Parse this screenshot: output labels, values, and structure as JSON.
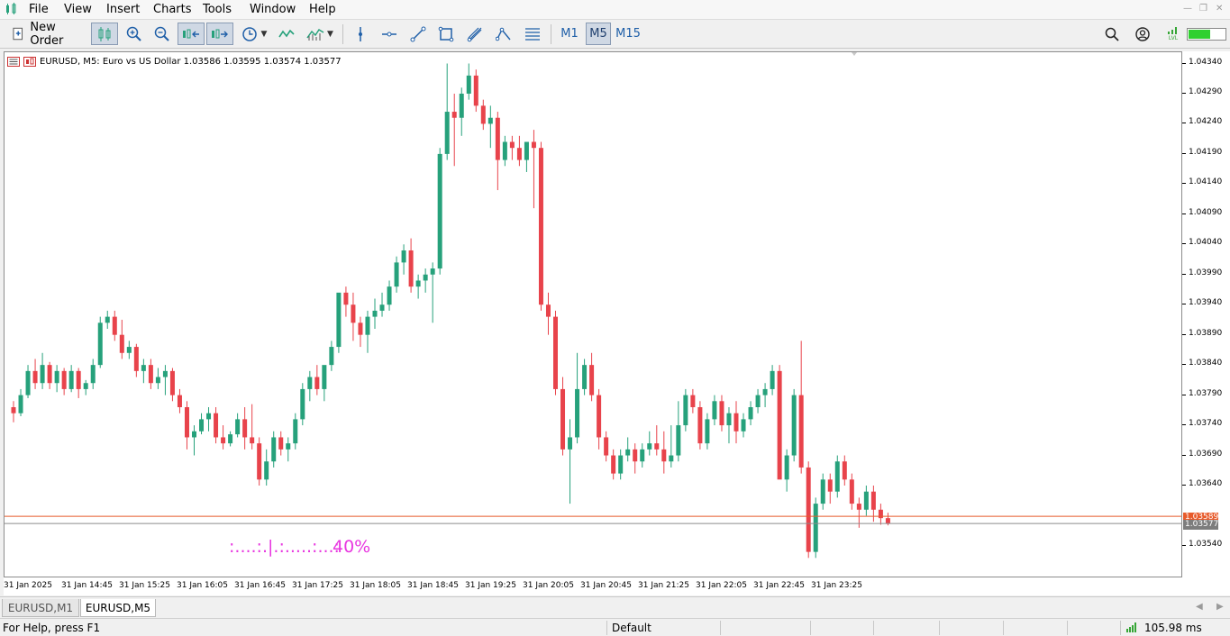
{
  "menu": {
    "items": [
      "File",
      "View",
      "Insert",
      "Charts",
      "Tools",
      "Window",
      "Help"
    ]
  },
  "toolbar": {
    "new_order_label": "New Order",
    "timeframes": [
      "M1",
      "M5",
      "M15"
    ],
    "active_timeframe": "M5",
    "connection_label": "LVL"
  },
  "chart": {
    "symbol": "EURUSD",
    "timeframe": "M5",
    "description": "Euro vs US Dollar",
    "ohlc": "1.03586 1.03595 1.03574 1.03577",
    "title_text": "EURUSD, M5:  Euro vs US Dollar  1.03586 1.03595 1.03574 1.03577",
    "indicator_text": ":....:.|.:.....:...:",
    "indicator_pct": "40%",
    "colors": {
      "bull": "#26a17b",
      "bear": "#e8434b",
      "ask_line": "#e85a2a",
      "bid_line": "#8c8c8c",
      "indicator": "#e838e0"
    }
  },
  "chart_data": {
    "type": "candlestick",
    "title": "EURUSD, M5:  Euro vs US Dollar  1.03586 1.03595 1.03574 1.03577",
    "price_axis_labels": [
      "1.04340",
      "1.04290",
      "1.04240",
      "1.04190",
      "1.04140",
      "1.04090",
      "1.04040",
      "1.03990",
      "1.03940",
      "1.03890",
      "1.03840",
      "1.03790",
      "1.03740",
      "1.03690",
      "1.03640",
      "1.03589",
      "1.03577",
      "1.03540"
    ],
    "time_axis_labels": [
      "31 Jan 2025",
      "31 Jan 14:45",
      "31 Jan 15:25",
      "31 Jan 16:05",
      "31 Jan 16:45",
      "31 Jan 17:25",
      "31 Jan 18:05",
      "31 Jan 18:45",
      "31 Jan 19:25",
      "31 Jan 20:05",
      "31 Jan 20:45",
      "31 Jan 21:25",
      "31 Jan 22:05",
      "31 Jan 22:45",
      "31 Jan 23:25"
    ],
    "ylim": [
      1.035,
      1.04355
    ],
    "ask_price": "1.03589",
    "bid_price": "1.03577",
    "candles": [
      [
        1.0377,
        1.0378,
        1.03745,
        1.0376
      ],
      [
        1.0376,
        1.038,
        1.03755,
        1.0379
      ],
      [
        1.0379,
        1.0384,
        1.03785,
        1.0383
      ],
      [
        1.0383,
        1.0385,
        1.038,
        1.0381
      ],
      [
        1.0381,
        1.0386,
        1.038,
        1.0384
      ],
      [
        1.0384,
        1.03845,
        1.038,
        1.0381
      ],
      [
        1.0381,
        1.0384,
        1.03795,
        1.0383
      ],
      [
        1.0383,
        1.03835,
        1.0379,
        1.038
      ],
      [
        1.038,
        1.0384,
        1.03795,
        1.0383
      ],
      [
        1.0383,
        1.03835,
        1.03785,
        1.038
      ],
      [
        1.038,
        1.03815,
        1.0379,
        1.0381
      ],
      [
        1.0381,
        1.0385,
        1.038,
        1.0384
      ],
      [
        1.0384,
        1.0392,
        1.03835,
        1.0391
      ],
      [
        1.0391,
        1.0393,
        1.039,
        1.0392
      ],
      [
        1.0392,
        1.0393,
        1.0388,
        1.0389
      ],
      [
        1.0389,
        1.03915,
        1.0385,
        1.0386
      ],
      [
        1.0386,
        1.0388,
        1.0385,
        1.0387
      ],
      [
        1.0387,
        1.03875,
        1.0382,
        1.0383
      ],
      [
        1.0383,
        1.0385,
        1.0381,
        1.0384
      ],
      [
        1.0384,
        1.0385,
        1.038,
        1.0381
      ],
      [
        1.0381,
        1.03835,
        1.038,
        1.0382
      ],
      [
        1.0382,
        1.0384,
        1.0379,
        1.0383
      ],
      [
        1.0383,
        1.03835,
        1.0378,
        1.0379
      ],
      [
        1.0379,
        1.038,
        1.0376,
        1.0377
      ],
      [
        1.0377,
        1.0378,
        1.037,
        1.0372
      ],
      [
        1.0372,
        1.0374,
        1.0369,
        1.0373
      ],
      [
        1.0373,
        1.0376,
        1.03725,
        1.0375
      ],
      [
        1.0375,
        1.0377,
        1.0373,
        1.0376
      ],
      [
        1.0376,
        1.0377,
        1.0371,
        1.0372
      ],
      [
        1.0372,
        1.0374,
        1.037,
        1.0371
      ],
      [
        1.0371,
        1.0373,
        1.03705,
        1.03725
      ],
      [
        1.03725,
        1.0376,
        1.0372,
        1.0375
      ],
      [
        1.0375,
        1.0377,
        1.037,
        1.0372
      ],
      [
        1.0372,
        1.03775,
        1.037,
        1.0371
      ],
      [
        1.0371,
        1.0372,
        1.0364,
        1.0365
      ],
      [
        1.0365,
        1.037,
        1.0364,
        1.0368
      ],
      [
        1.0368,
        1.0373,
        1.0367,
        1.0372
      ],
      [
        1.0372,
        1.0373,
        1.0369,
        1.037
      ],
      [
        1.037,
        1.0372,
        1.0368,
        1.0371
      ],
      [
        1.0371,
        1.0376,
        1.037,
        1.0375
      ],
      [
        1.0375,
        1.0381,
        1.0374,
        1.038
      ],
      [
        1.038,
        1.0383,
        1.0378,
        1.0382
      ],
      [
        1.0382,
        1.0384,
        1.0379,
        1.038
      ],
      [
        1.038,
        1.0383,
        1.0378,
        1.0384
      ],
      [
        1.0384,
        1.0388,
        1.0383,
        1.0387
      ],
      [
        1.0387,
        1.03905,
        1.0386,
        1.0396
      ],
      [
        1.0396,
        1.0397,
        1.0392,
        1.0394
      ],
      [
        1.0394,
        1.0396,
        1.0388,
        1.0391
      ],
      [
        1.0391,
        1.0392,
        1.0387,
        1.0389
      ],
      [
        1.0389,
        1.0393,
        1.0386,
        1.0392
      ],
      [
        1.0392,
        1.0395,
        1.039,
        1.0393
      ],
      [
        1.0393,
        1.0396,
        1.0392,
        1.0394
      ],
      [
        1.0394,
        1.0398,
        1.0393,
        1.0397
      ],
      [
        1.0397,
        1.0402,
        1.0396,
        1.0401
      ],
      [
        1.0401,
        1.0404,
        1.0399,
        1.0403
      ],
      [
        1.0403,
        1.0405,
        1.0396,
        1.0397
      ],
      [
        1.0397,
        1.0399,
        1.0395,
        1.0398
      ],
      [
        1.0398,
        1.04,
        1.0396,
        1.0399
      ],
      [
        1.0399,
        1.0401,
        1.0391,
        1.04
      ],
      [
        1.04,
        1.042,
        1.0399,
        1.0419
      ],
      [
        1.0419,
        1.0434,
        1.0418,
        1.0426
      ],
      [
        1.0426,
        1.0429,
        1.0417,
        1.0425
      ],
      [
        1.0425,
        1.043,
        1.0422,
        1.0429
      ],
      [
        1.0429,
        1.0434,
        1.0428,
        1.0432
      ],
      [
        1.0432,
        1.0433,
        1.0426,
        1.0427
      ],
      [
        1.0427,
        1.0428,
        1.0423,
        1.0424
      ],
      [
        1.0424,
        1.0427,
        1.042,
        1.0425
      ],
      [
        1.0425,
        1.0426,
        1.0413,
        1.0418
      ],
      [
        1.0418,
        1.0422,
        1.0417,
        1.0421
      ],
      [
        1.0421,
        1.0422,
        1.0418,
        1.042
      ],
      [
        1.042,
        1.0422,
        1.0417,
        1.0418
      ],
      [
        1.0418,
        1.042,
        1.0416,
        1.0421
      ],
      [
        1.0421,
        1.0423,
        1.041,
        1.042
      ],
      [
        1.042,
        1.0421,
        1.0393,
        1.0394
      ],
      [
        1.0394,
        1.0396,
        1.0389,
        1.0392
      ],
      [
        1.0392,
        1.0393,
        1.0379,
        1.038
      ],
      [
        1.038,
        1.0382,
        1.0369,
        1.037
      ],
      [
        1.037,
        1.0375,
        1.0361,
        1.0372
      ],
      [
        1.0372,
        1.0386,
        1.0371,
        1.038
      ],
      [
        1.038,
        1.0385,
        1.0379,
        1.0384
      ],
      [
        1.0384,
        1.0386,
        1.0378,
        1.0379
      ],
      [
        1.0379,
        1.038,
        1.037,
        1.0372
      ],
      [
        1.0372,
        1.0373,
        1.0368,
        1.0369
      ],
      [
        1.0369,
        1.037,
        1.0365,
        1.0366
      ],
      [
        1.0366,
        1.037,
        1.0365,
        1.0369
      ],
      [
        1.0369,
        1.0372,
        1.0368,
        1.037
      ],
      [
        1.037,
        1.0371,
        1.0366,
        1.0368
      ],
      [
        1.0368,
        1.0371,
        1.0367,
        1.037
      ],
      [
        1.037,
        1.0373,
        1.0369,
        1.0371
      ],
      [
        1.0371,
        1.0374,
        1.0369,
        1.037
      ],
      [
        1.037,
        1.0373,
        1.0366,
        1.0368
      ],
      [
        1.0368,
        1.0374,
        1.0367,
        1.0369
      ],
      [
        1.0369,
        1.0378,
        1.0368,
        1.0374
      ],
      [
        1.0374,
        1.038,
        1.0373,
        1.0379
      ],
      [
        1.0379,
        1.038,
        1.0376,
        1.0377
      ],
      [
        1.0377,
        1.0378,
        1.037,
        1.0371
      ],
      [
        1.0371,
        1.0376,
        1.037,
        1.0375
      ],
      [
        1.0375,
        1.0379,
        1.0374,
        1.0378
      ],
      [
        1.0378,
        1.0379,
        1.0373,
        1.0374
      ],
      [
        1.0374,
        1.0377,
        1.0371,
        1.0376
      ],
      [
        1.0376,
        1.0378,
        1.0371,
        1.0373
      ],
      [
        1.0373,
        1.0376,
        1.0372,
        1.0375
      ],
      [
        1.0375,
        1.0378,
        1.0374,
        1.0377
      ],
      [
        1.0377,
        1.038,
        1.0376,
        1.0379
      ],
      [
        1.0379,
        1.0381,
        1.0377,
        1.038
      ],
      [
        1.038,
        1.0384,
        1.0379,
        1.0383
      ],
      [
        1.0383,
        1.0384,
        1.037,
        1.0365
      ],
      [
        1.0365,
        1.037,
        1.0363,
        1.0369
      ],
      [
        1.0369,
        1.038,
        1.0368,
        1.0379
      ],
      [
        1.0379,
        1.0388,
        1.0366,
        1.0367
      ],
      [
        1.0367,
        1.0368,
        1.0352,
        1.0353
      ],
      [
        1.0353,
        1.0362,
        1.0352,
        1.0361
      ],
      [
        1.0361,
        1.0366,
        1.036,
        1.0365
      ],
      [
        1.0365,
        1.0366,
        1.0361,
        1.0363
      ],
      [
        1.0363,
        1.0369,
        1.0362,
        1.0368
      ],
      [
        1.0368,
        1.0369,
        1.0364,
        1.0365
      ],
      [
        1.0365,
        1.0366,
        1.036,
        1.0361
      ],
      [
        1.0361,
        1.0362,
        1.0357,
        1.036
      ],
      [
        1.036,
        1.0364,
        1.0359,
        1.0363
      ],
      [
        1.0363,
        1.0364,
        1.0358,
        1.036
      ],
      [
        1.036,
        1.0361,
        1.03575,
        1.03586
      ],
      [
        1.03586,
        1.03595,
        1.03574,
        1.03577
      ]
    ]
  },
  "tabs": {
    "items": [
      "EURUSD,M1",
      "EURUSD,M5"
    ],
    "active": "EURUSD,M5"
  },
  "status": {
    "help": "For Help, press F1",
    "profile": "Default",
    "ping": "105.98 ms"
  }
}
